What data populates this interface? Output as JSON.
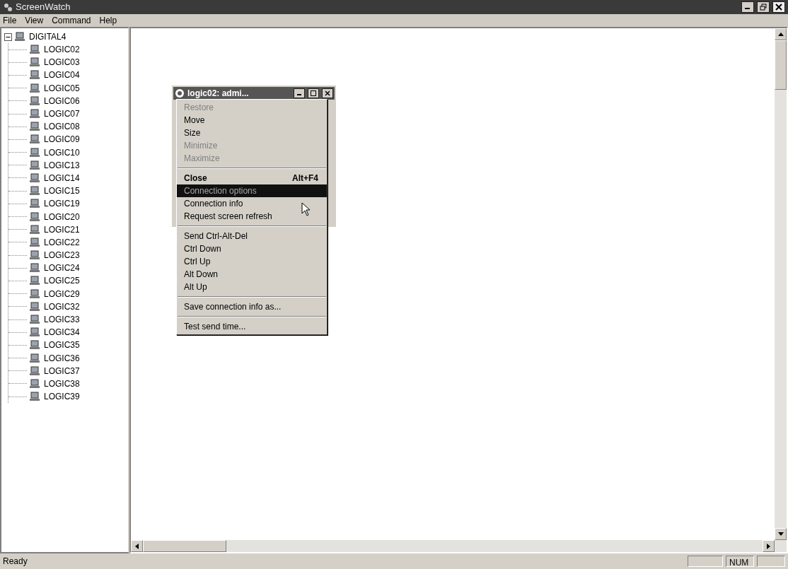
{
  "window": {
    "title": "ScreenWatch"
  },
  "menu_bar": [
    "File",
    "View",
    "Command",
    "Help"
  ],
  "tree": {
    "label": "DIGITAL4",
    "expanded": true,
    "children": [
      {
        "label": "LOGIC02"
      },
      {
        "label": "LOGIC03"
      },
      {
        "label": "LOGIC04"
      },
      {
        "label": "LOGIC05"
      },
      {
        "label": "LOGIC06"
      },
      {
        "label": "LOGIC07"
      },
      {
        "label": "LOGIC08"
      },
      {
        "label": "LOGIC09"
      },
      {
        "label": "LOGIC10"
      },
      {
        "label": "LOGIC13"
      },
      {
        "label": "LOGIC14"
      },
      {
        "label": "LOGIC15"
      },
      {
        "label": "LOGIC19"
      },
      {
        "label": "LOGIC20"
      },
      {
        "label": "LOGIC21"
      },
      {
        "label": "LOGIC22"
      },
      {
        "label": "LOGIC23"
      },
      {
        "label": "LOGIC24"
      },
      {
        "label": "LOGIC25"
      },
      {
        "label": "LOGIC29"
      },
      {
        "label": "LOGIC32"
      },
      {
        "label": "LOGIC33"
      },
      {
        "label": "LOGIC34"
      },
      {
        "label": "LOGIC35"
      },
      {
        "label": "LOGIC36"
      },
      {
        "label": "LOGIC37"
      },
      {
        "label": "LOGIC38"
      },
      {
        "label": "LOGIC39"
      }
    ]
  },
  "child_window": {
    "title": "logic02: admi..."
  },
  "system_menu": [
    {
      "kind": "item",
      "label": "Restore",
      "disabled": true,
      "selected": false
    },
    {
      "kind": "item",
      "label": "Move",
      "disabled": false,
      "selected": false
    },
    {
      "kind": "item",
      "label": "Size",
      "disabled": false,
      "selected": false
    },
    {
      "kind": "item",
      "label": "Minimize",
      "disabled": true,
      "selected": false
    },
    {
      "kind": "item",
      "label": "Maximize",
      "disabled": true,
      "selected": false
    },
    {
      "kind": "separator"
    },
    {
      "kind": "item",
      "label": "Close",
      "shortcut": "Alt+F4",
      "bold": true,
      "disabled": false,
      "selected": false
    },
    {
      "kind": "item",
      "label": "Connection options",
      "disabled": true,
      "selected": true
    },
    {
      "kind": "item",
      "label": "Connection info",
      "disabled": false,
      "selected": false
    },
    {
      "kind": "item",
      "label": "Request screen refresh",
      "disabled": false,
      "selected": false
    },
    {
      "kind": "separator"
    },
    {
      "kind": "item",
      "label": "Send Ctrl-Alt-Del",
      "disabled": false,
      "selected": false
    },
    {
      "kind": "item",
      "label": "Ctrl Down",
      "disabled": false,
      "selected": false
    },
    {
      "kind": "item",
      "label": "Ctrl Up",
      "disabled": false,
      "selected": false
    },
    {
      "kind": "item",
      "label": "Alt Down",
      "disabled": false,
      "selected": false
    },
    {
      "kind": "item",
      "label": "Alt Up",
      "disabled": false,
      "selected": false
    },
    {
      "kind": "separator"
    },
    {
      "kind": "item",
      "label": "Save connection info as...",
      "disabled": false,
      "selected": false
    },
    {
      "kind": "separator"
    },
    {
      "kind": "item",
      "label": "Test send time...",
      "disabled": false,
      "selected": false
    }
  ],
  "status_bar": {
    "message": "Ready",
    "indicators": [
      "NUM"
    ]
  }
}
